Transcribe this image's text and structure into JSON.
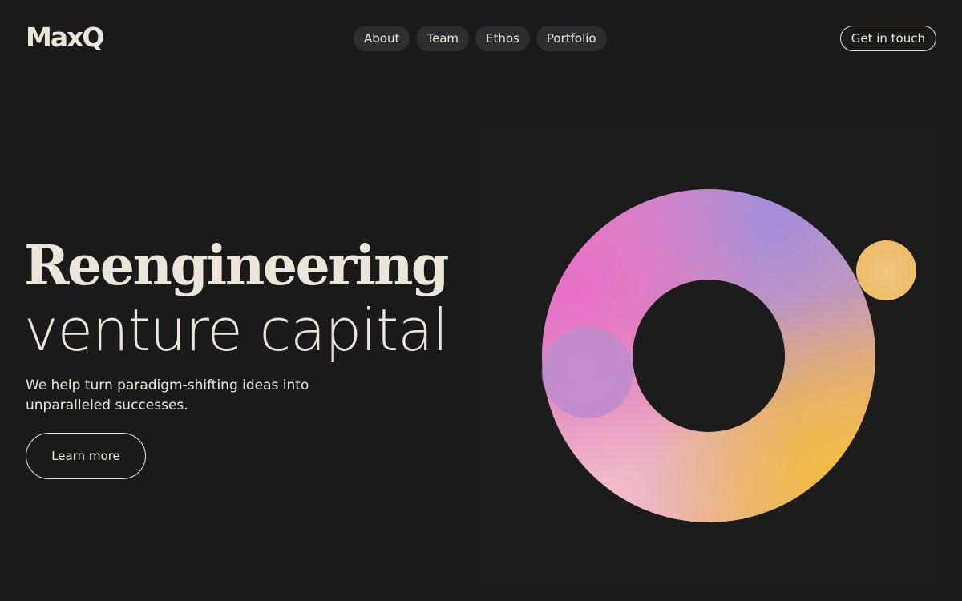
{
  "header": {
    "logo_text": "MaxQ",
    "nav": [
      {
        "label": "About"
      },
      {
        "label": "Team"
      },
      {
        "label": "Ethos"
      },
      {
        "label": "Portfolio"
      }
    ],
    "cta_label": "Get in touch"
  },
  "hero": {
    "title_line1": "Reengineering",
    "title_line2": "venture capital",
    "subtitle": "We help turn paradigm-shifting ideas into unparalleled successes.",
    "button_label": "Learn more"
  },
  "colors": {
    "background": "#1a1a1a",
    "text": "#ece6da",
    "pill": "#2e2e2e",
    "ring_gradient": [
      "#e86ec8",
      "#a08cdc",
      "#f5bece",
      "#f0be3c"
    ],
    "orb_gold": "#f0c070",
    "orb_purple": "#c08ccc"
  }
}
